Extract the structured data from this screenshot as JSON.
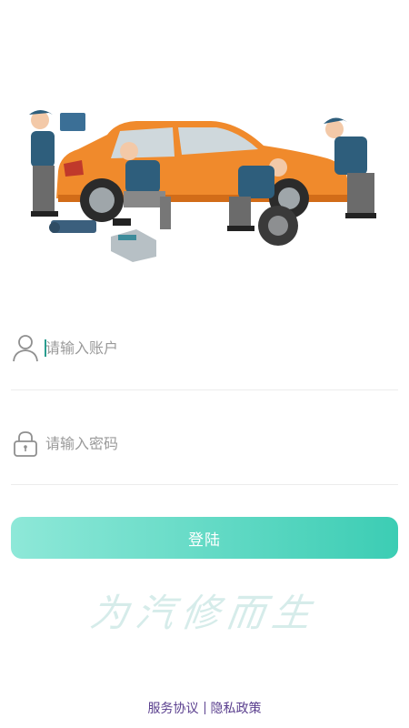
{
  "hero": {
    "image_name": "car-repair-illustration"
  },
  "account": {
    "placeholder": "请输入账户",
    "icon": "user-icon"
  },
  "password": {
    "placeholder": "请输入密码",
    "icon": "lock-icon"
  },
  "login": {
    "label": "登陆",
    "gradient_start": "#8ee8d8",
    "gradient_end": "#3ccdb4"
  },
  "slogan": "为汽修而生",
  "footer": {
    "service_agreement": "服务协议",
    "privacy_policy": "隐私政策"
  }
}
